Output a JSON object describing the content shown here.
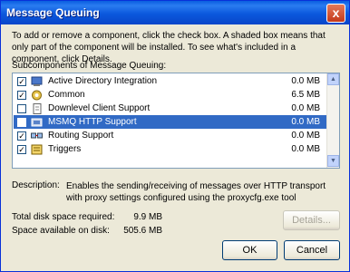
{
  "window": {
    "title": "Message Queuing",
    "close_glyph": "x"
  },
  "intro": "To add or remove a component, click the check box. A shaded box means that only part of the component will be installed. To see what's included in a component, click Details.",
  "list": {
    "label": "Subcomponents of Message Queuing:",
    "items": [
      {
        "label": "Active Directory Integration",
        "size": "0.0 MB",
        "checked": true,
        "icon": "active-directory-icon"
      },
      {
        "label": "Common",
        "size": "6.5 MB",
        "checked": true,
        "icon": "common-icon"
      },
      {
        "label": "Downlevel Client Support",
        "size": "0.0 MB",
        "checked": false,
        "icon": "document-icon"
      },
      {
        "label": "MSMQ HTTP Support",
        "size": "0.0 MB",
        "checked": false,
        "icon": "http-support-icon",
        "selected": true
      },
      {
        "label": "Routing Support",
        "size": "0.0 MB",
        "checked": true,
        "icon": "routing-icon"
      },
      {
        "label": "Triggers",
        "size": "0.0 MB",
        "checked": true,
        "icon": "triggers-icon"
      }
    ]
  },
  "description": {
    "label": "Description:",
    "text": "Enables the sending/receiving of messages over HTTP transport with proxy settings configured using the proxycfg.exe tool"
  },
  "stats": {
    "total_label": "Total disk space required:",
    "total_value": "9.9 MB",
    "available_label": "Space available on disk:",
    "available_value": "505.6 MB"
  },
  "buttons": {
    "details": "Details...",
    "ok": "OK",
    "cancel": "Cancel"
  },
  "colors": {
    "title_bar": "#0a5ee0",
    "selection": "#316ac5",
    "dialog_bg": "#ece9d8"
  }
}
